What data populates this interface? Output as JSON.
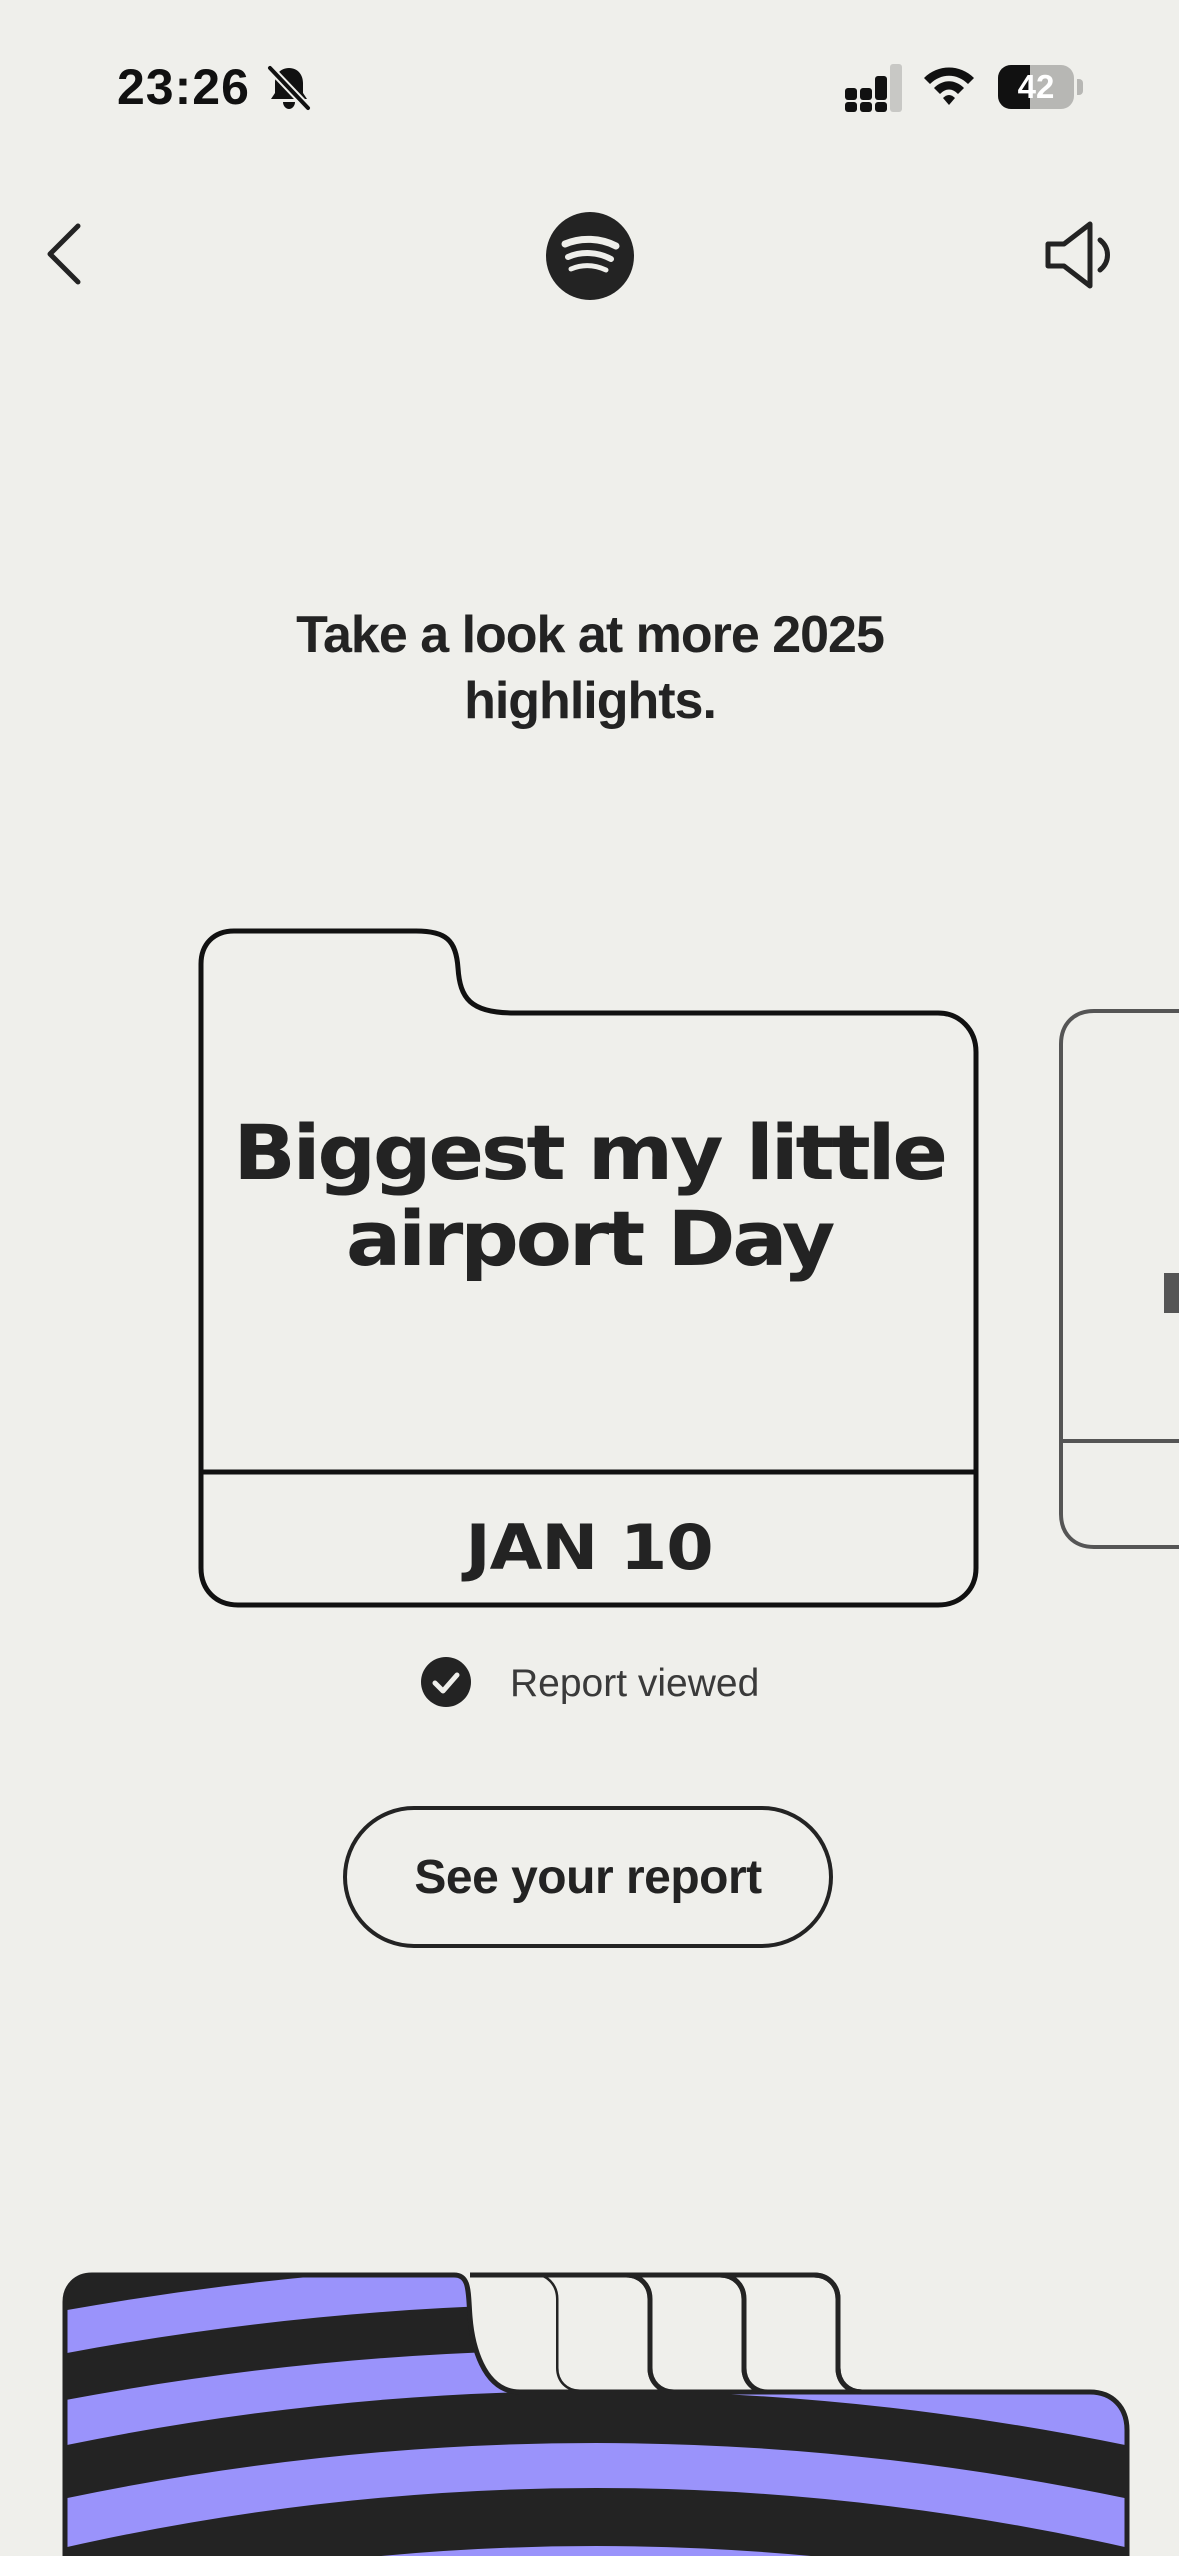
{
  "status_bar": {
    "time": "23:26",
    "battery_level": "42",
    "battery_fraction": 0.42,
    "icons": [
      "bell-slash-icon",
      "cellular-signal-icon",
      "wifi-icon",
      "battery-icon"
    ]
  },
  "nav": {
    "back_icon": "chevron-left-icon",
    "logo": "spotify-logo-icon",
    "sound_icon": "speaker-icon"
  },
  "heading": "Take a look at more 2025 highlights.",
  "card": {
    "title": "Biggest my little airport Day",
    "date": "JAN 10"
  },
  "report_status": {
    "icon": "check-circle-icon",
    "text": "Report viewed"
  },
  "cta": {
    "label": "See your report"
  },
  "colors": {
    "background": "#efefeb",
    "ink": "#232323",
    "accent": "#9a93fb"
  }
}
